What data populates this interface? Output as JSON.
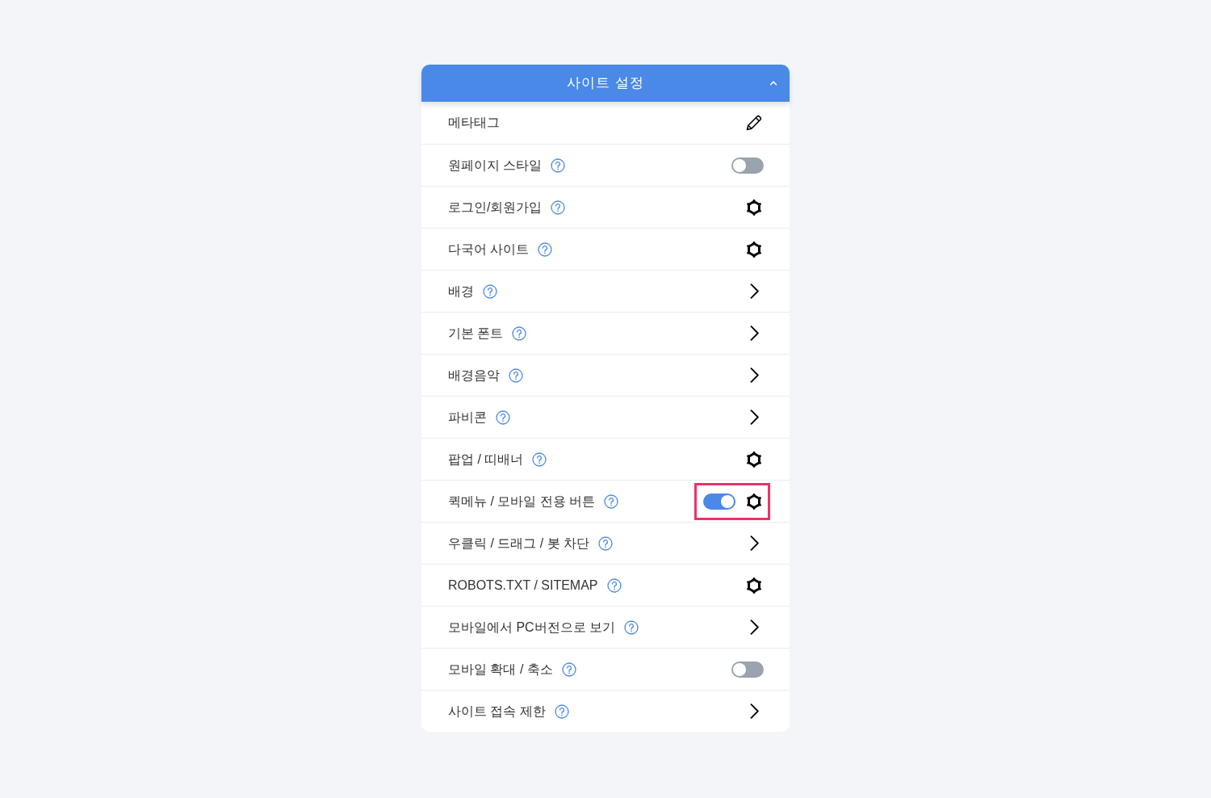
{
  "panel": {
    "title": "사이트 설정",
    "expanded": true
  },
  "items": [
    {
      "label": "메타태그",
      "help": false,
      "kind": "edit",
      "highlighted": false
    },
    {
      "label": "원페이지 스타일",
      "help": true,
      "kind": "toggle",
      "on": false,
      "highlighted": false
    },
    {
      "label": "로그인/회원가입",
      "help": true,
      "kind": "settings",
      "highlighted": false
    },
    {
      "label": "다국어 사이트",
      "help": true,
      "kind": "settings",
      "highlighted": false
    },
    {
      "label": "배경",
      "help": true,
      "kind": "link",
      "highlighted": false
    },
    {
      "label": "기본 폰트",
      "help": true,
      "kind": "link",
      "highlighted": false
    },
    {
      "label": "배경음악",
      "help": true,
      "kind": "link",
      "highlighted": false
    },
    {
      "label": "파비콘",
      "help": true,
      "kind": "link",
      "highlighted": false
    },
    {
      "label": "팝업 / 띠배너",
      "help": true,
      "kind": "settings",
      "highlighted": false
    },
    {
      "label": "퀵메뉴 / 모바일 전용 버튼",
      "help": true,
      "kind": "toggle_settings",
      "on": true,
      "highlighted": true
    },
    {
      "label": "우클릭 / 드래그 / 봇 차단",
      "help": true,
      "kind": "link",
      "highlighted": false
    },
    {
      "label": "ROBOTS.TXT / SITEMAP",
      "help": true,
      "kind": "settings",
      "highlighted": false
    },
    {
      "label": "모바일에서 PC버전으로 보기",
      "help": true,
      "kind": "link",
      "highlighted": false
    },
    {
      "label": "모바일 확대 / 축소",
      "help": true,
      "kind": "toggle",
      "on": false,
      "highlighted": false
    },
    {
      "label": "사이트 접속 제한",
      "help": true,
      "kind": "link",
      "highlighted": false
    }
  ]
}
